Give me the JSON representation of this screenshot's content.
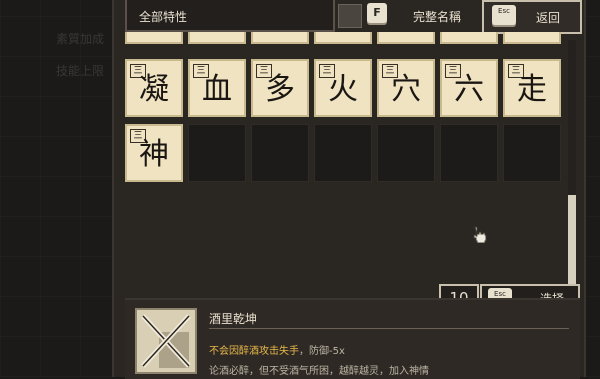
{
  "filter": {
    "label": "全部特性"
  },
  "toolbar": {
    "toggle_key": "F",
    "fullname_label": "完整名稱",
    "back_key": "Esc",
    "back_label": "返回"
  },
  "background_rows": [
    "素質加成",
    "技能上限"
  ],
  "row_partial": [
    "",
    "",
    "",
    "",
    "",
    "",
    ""
  ],
  "row1": [
    {
      "badge": "三",
      "glyph": "凝"
    },
    {
      "badge": "三",
      "glyph": "血"
    },
    {
      "badge": "三",
      "glyph": "多"
    },
    {
      "badge": "三",
      "glyph": "火"
    },
    {
      "badge": "三",
      "glyph": "穴"
    },
    {
      "badge": "三",
      "glyph": "六"
    },
    {
      "badge": "三",
      "glyph": "走"
    }
  ],
  "row2": [
    {
      "badge": "三",
      "glyph": "神"
    }
  ],
  "selection": {
    "count": "10",
    "key": "Esc",
    "select_label": "选择"
  },
  "details": {
    "name": "酒里乾坤",
    "effect_highlight": "不会因醉酒攻击失手",
    "effect_extra": "，防御-5x",
    "description": "论酒必醉，但不受酒气所困，越醉越灵，加入神情"
  },
  "colors": {
    "tile_bg": "#efe3c2",
    "highlight": "#e7b84a",
    "panel": "#2a2622"
  }
}
